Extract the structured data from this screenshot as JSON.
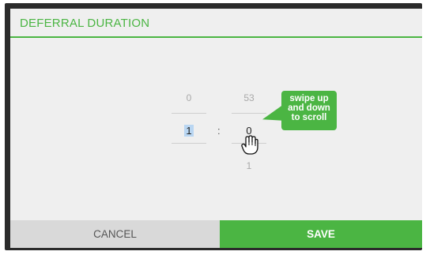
{
  "dialog": {
    "title": "DEFERRAL DURATION"
  },
  "picker": {
    "left": {
      "above": "0",
      "selected": "1",
      "below": ""
    },
    "separator": ":",
    "right": {
      "above": "53",
      "selected": "0",
      "below": "1"
    }
  },
  "tooltip": {
    "line1": "swipe up",
    "line2": "and down",
    "line3": "to scroll"
  },
  "buttons": {
    "cancel": "CANCEL",
    "save": "SAVE"
  },
  "colors": {
    "accent": "#4bb543",
    "cancel_bg": "#d9d9d9",
    "dialog_bg": "#efefef"
  },
  "icons": {
    "cursor": "hand-grab-icon"
  }
}
